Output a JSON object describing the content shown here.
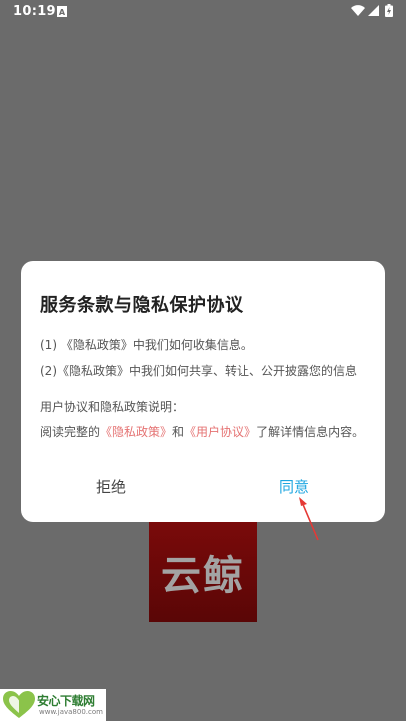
{
  "status_bar": {
    "time": "10:19",
    "notification_icon": "A"
  },
  "splash": {
    "logo_text": "云鲸"
  },
  "dialog": {
    "title": "服务条款与隐私保护协议",
    "line1": {
      "prefix": "(1) ",
      "link": "《隐私政策》",
      "suffix": "中我们如何收集信息。"
    },
    "line2": {
      "prefix": "(2)",
      "link": "《隐私政策》",
      "suffix": "中我们如何共享、转让、公开披露您的信息"
    },
    "line3": "用户协议和隐私政策说明：",
    "line4": {
      "prefix": "阅读完整的",
      "link1": "《隐私政策》",
      "mid": "和",
      "link2": "《用户协议》",
      "suffix": "了解详情信息内容。"
    },
    "refuse_label": "拒绝",
    "agree_label": "同意"
  },
  "watermark": {
    "title": "安心下载网",
    "url": "www.java800.com"
  },
  "colors": {
    "agree": "#1ea6e0",
    "link": "#e57373",
    "overlay": "#6b6b6b"
  }
}
